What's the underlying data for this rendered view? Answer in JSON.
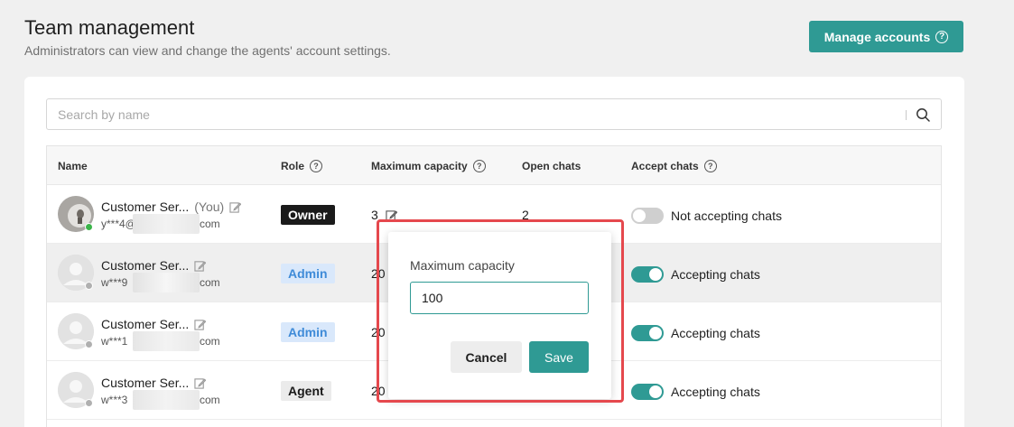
{
  "header": {
    "title": "Team management",
    "subtitle": "Administrators can view and change the agents' account settings.",
    "manage_button": "Manage accounts"
  },
  "search": {
    "placeholder": "Search by name"
  },
  "columns": {
    "name": "Name",
    "role": "Role",
    "max_capacity": "Maximum capacity",
    "open_chats": "Open chats",
    "accept_chats": "Accept chats"
  },
  "rows": [
    {
      "name": "Customer Ser...",
      "you": "(You)",
      "email_prefix": "y***4@",
      "email_suffix": "com",
      "role": "Owner",
      "capacity": "3",
      "open_chats": "2",
      "accepting": false,
      "accept_label": "Not accepting chats",
      "status": "online"
    },
    {
      "name": "Customer Ser...",
      "you": "",
      "email_prefix": "w***9",
      "email_suffix": "com",
      "role": "Admin",
      "capacity": "20",
      "open_chats": "",
      "accepting": true,
      "accept_label": "Accepting chats",
      "status": "offline"
    },
    {
      "name": "Customer Ser...",
      "you": "",
      "email_prefix": "w***1",
      "email_suffix": "com",
      "role": "Admin",
      "capacity": "20",
      "open_chats": "",
      "accepting": true,
      "accept_label": "Accepting chats",
      "status": "offline"
    },
    {
      "name": "Customer Ser...",
      "you": "",
      "email_prefix": "w***3",
      "email_suffix": "com",
      "role": "Agent",
      "capacity": "20",
      "open_chats": "",
      "accepting": true,
      "accept_label": "Accepting chats",
      "status": "offline"
    }
  ],
  "popup": {
    "label": "Maximum capacity",
    "value": "100",
    "cancel": "Cancel",
    "save": "Save"
  },
  "colors": {
    "accent": "#2f9a94",
    "highlight": "#e5484d",
    "online": "#3bb54a"
  }
}
